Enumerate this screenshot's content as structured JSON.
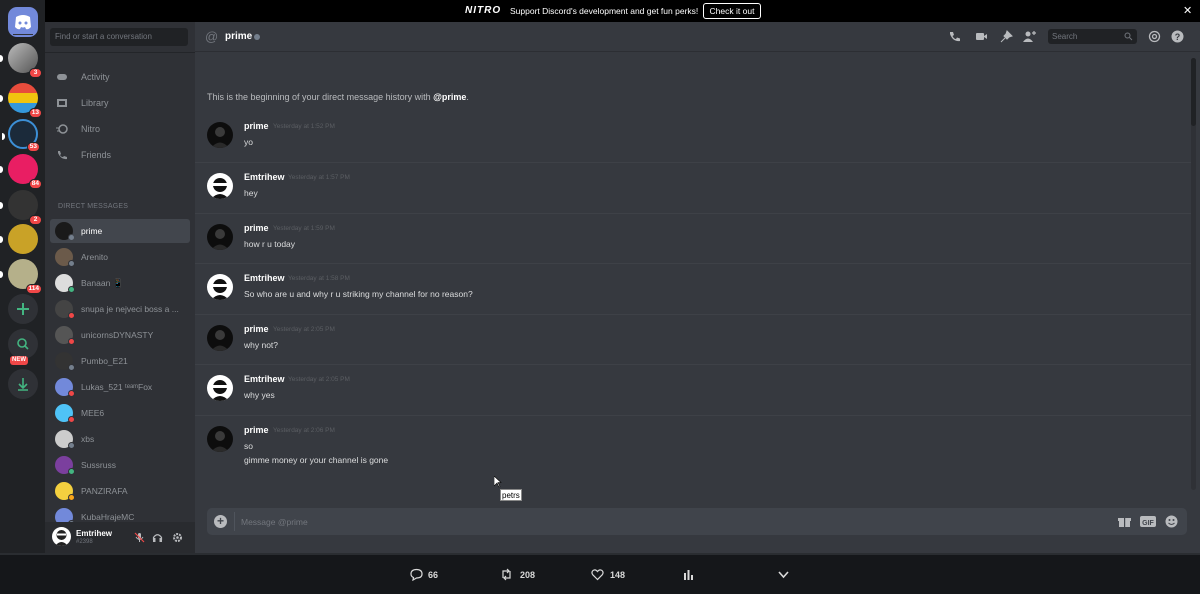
{
  "banner": {
    "logo": "NITRO",
    "text": "Support Discord's development and get fun perks!",
    "button": "Check it out"
  },
  "servers": [
    {
      "name": "home",
      "badge": ""
    },
    {
      "name": "server-1",
      "badge": "3"
    },
    {
      "name": "server-2",
      "badge": "13"
    },
    {
      "name": "server-3",
      "badge": "53"
    },
    {
      "name": "server-4",
      "badge": "84"
    },
    {
      "name": "server-5",
      "badge": "2"
    },
    {
      "name": "server-6",
      "badge": ""
    },
    {
      "name": "server-7",
      "badge": "114"
    },
    {
      "name": "add-server",
      "badge": ""
    },
    {
      "name": "explore",
      "badge": "NEW"
    },
    {
      "name": "download",
      "badge": ""
    }
  ],
  "sidebar": {
    "search_placeholder": "Find or start a conversation",
    "nav": [
      "Activity",
      "Library",
      "Nitro",
      "Friends"
    ],
    "dm_header": "DIRECT MESSAGES",
    "dms": [
      {
        "name": "prime",
        "status": "#747f8d",
        "avatar": "#1a1a1a"
      },
      {
        "name": "Arenito",
        "status": "#747f8d",
        "avatar": "#6b5a4a"
      },
      {
        "name": "Banaan 📱",
        "status": "#43b581",
        "avatar": "#ddd"
      },
      {
        "name": "snupa je nejveci boss a ...",
        "status": "#f04747",
        "avatar": "#444"
      },
      {
        "name": "unicornsDYNASTY",
        "status": "#f04747",
        "avatar": "#555"
      },
      {
        "name": "Pumbo_E21",
        "status": "#747f8d",
        "avatar": "#333"
      },
      {
        "name": "Lukas_521 ᵗᵉᵃᵐFox",
        "status": "#f04747",
        "avatar": "#7289da"
      },
      {
        "name": "MEE6",
        "status": "#f04747",
        "avatar": "#4fc3f7"
      },
      {
        "name": "xbs",
        "status": "#747f8d",
        "avatar": "#ccc"
      },
      {
        "name": "Sussruss",
        "status": "#43b581",
        "avatar": "#7b3f9e"
      },
      {
        "name": "PANZIRAFA",
        "status": "#faa61a",
        "avatar": "#f4d03f"
      },
      {
        "name": "KubaHrajeMC",
        "status": "#747f8d",
        "avatar": "#7289da"
      }
    ]
  },
  "user_panel": {
    "name": "Emtrihew",
    "tag": "#2398"
  },
  "chat_header": {
    "at": "@",
    "name": "prime",
    "search_placeholder": "Search"
  },
  "intro": {
    "prefix": "This is the beginning of your direct message history with ",
    "handle": "@prime",
    "suffix": "."
  },
  "messages": [
    {
      "author": "prime",
      "time": "Yesterday at 1:52 PM",
      "lines": [
        "yo"
      ]
    },
    {
      "author": "Emtrihew",
      "time": "Yesterday at 1:57 PM",
      "lines": [
        "hey"
      ]
    },
    {
      "author": "prime",
      "time": "Yesterday at 1:59 PM",
      "lines": [
        "how r u today"
      ]
    },
    {
      "author": "Emtrihew",
      "time": "Yesterday at 1:58 PM",
      "lines": [
        "So who are u and why r u striking my channel for no reason?"
      ]
    },
    {
      "author": "prime",
      "time": "Yesterday at 2:05 PM",
      "lines": [
        "why not?"
      ]
    },
    {
      "author": "Emtrihew",
      "time": "Yesterday at 2:05 PM",
      "lines": [
        "why yes"
      ]
    },
    {
      "author": "prime",
      "time": "Yesterday at 2:06 PM",
      "lines": [
        "so",
        "gimme money or your channel is gone"
      ]
    }
  ],
  "tooltip": "petrs",
  "composer": {
    "placeholder": "Message @prime"
  },
  "tweet": {
    "replies": "66",
    "retweets": "208",
    "likes": "148"
  }
}
